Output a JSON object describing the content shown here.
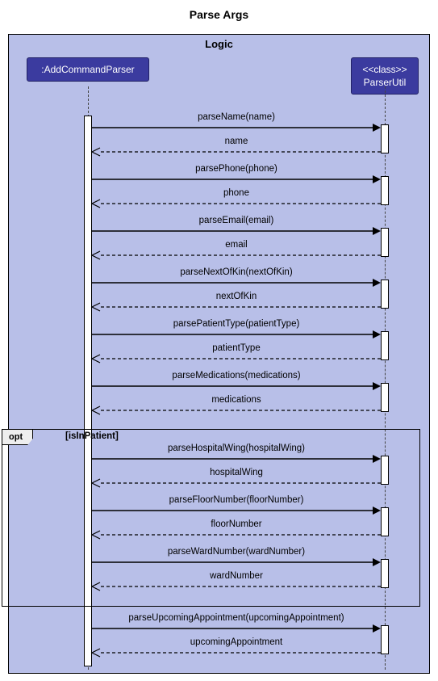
{
  "title": "Parse Args",
  "frame_label": "Logic",
  "participants": {
    "left": ":AddCommandParser",
    "right_stereo": "<<class>>",
    "right_name": "ParserUtil"
  },
  "opt": {
    "label": "opt",
    "guard": "[isInPatient]"
  },
  "messages": [
    {
      "call": "parseName(name)",
      "ret": "name"
    },
    {
      "call": "parsePhone(phone)",
      "ret": "phone"
    },
    {
      "call": "parseEmail(email)",
      "ret": "email"
    },
    {
      "call": "parseNextOfKin(nextOfKin)",
      "ret": "nextOfKin"
    },
    {
      "call": "parsePatientType(patientType)",
      "ret": "patientType"
    },
    {
      "call": "parseMedications(medications)",
      "ret": "medications"
    },
    {
      "call": "parseHospitalWing(hospitalWing)",
      "ret": "hospitalWing"
    },
    {
      "call": "parseFloorNumber(floorNumber)",
      "ret": "floorNumber"
    },
    {
      "call": "parseWardNumber(wardNumber)",
      "ret": "wardNumber"
    },
    {
      "call": "parseUpcomingAppointment(upcomingAppointment)",
      "ret": "upcomingAppointment"
    }
  ],
  "chart_data": {
    "type": "sequence-diagram",
    "title": "Parse Args",
    "frame": "Logic",
    "participants": [
      {
        "name": ":AddCommandParser",
        "type": "instance"
      },
      {
        "name": "ParserUtil",
        "type": "class",
        "stereotype": "<<class>>"
      }
    ],
    "interactions": [
      {
        "from": ":AddCommandParser",
        "to": "ParserUtil",
        "message": "parseName(name)",
        "return": "name"
      },
      {
        "from": ":AddCommandParser",
        "to": "ParserUtil",
        "message": "parsePhone(phone)",
        "return": "phone"
      },
      {
        "from": ":AddCommandParser",
        "to": "ParserUtil",
        "message": "parseEmail(email)",
        "return": "email"
      },
      {
        "from": ":AddCommandParser",
        "to": "ParserUtil",
        "message": "parseNextOfKin(nextOfKin)",
        "return": "nextOfKin"
      },
      {
        "from": ":AddCommandParser",
        "to": "ParserUtil",
        "message": "parsePatientType(patientType)",
        "return": "patientType"
      },
      {
        "from": ":AddCommandParser",
        "to": "ParserUtil",
        "message": "parseMedications(medications)",
        "return": "medications"
      },
      {
        "fragment": "opt",
        "guard": "isInPatient",
        "interactions": [
          {
            "from": ":AddCommandParser",
            "to": "ParserUtil",
            "message": "parseHospitalWing(hospitalWing)",
            "return": "hospitalWing"
          },
          {
            "from": ":AddCommandParser",
            "to": "ParserUtil",
            "message": "parseFloorNumber(floorNumber)",
            "return": "floorNumber"
          },
          {
            "from": ":AddCommandParser",
            "to": "ParserUtil",
            "message": "parseWardNumber(wardNumber)",
            "return": "wardNumber"
          }
        ]
      },
      {
        "from": ":AddCommandParser",
        "to": "ParserUtil",
        "message": "parseUpcomingAppointment(upcomingAppointment)",
        "return": "upcomingAppointment"
      }
    ]
  }
}
